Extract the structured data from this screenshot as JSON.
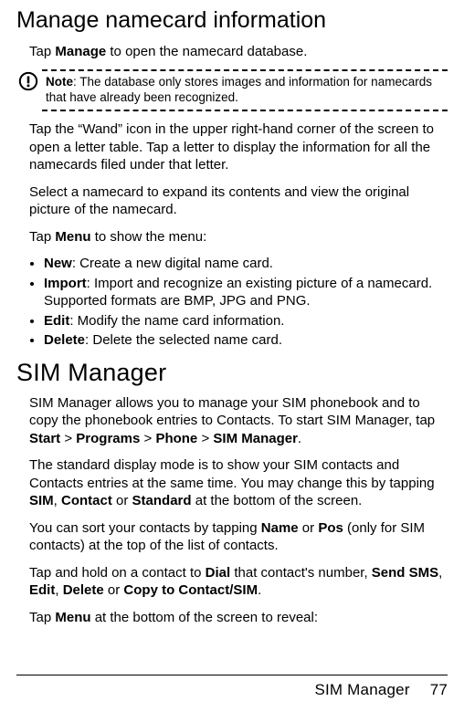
{
  "section1": {
    "title": "Manage namecard information",
    "p1_pre": "Tap ",
    "p1_bold": "Manage",
    "p1_post": " to open the namecard database.",
    "note_label": "Note",
    "note_text": ": The database only stores images and information for namecards that have already been recognized.",
    "p2": "Tap the “Wand” icon in the upper right-hand corner of the screen to open a letter table. Tap a letter to display the information for all the namecards filed under that letter.",
    "p3": "Select a namecard to expand its contents and view the original picture of the namecard.",
    "p4_pre": "Tap ",
    "p4_bold": "Menu",
    "p4_post": " to show the menu:",
    "menu": [
      {
        "name": "New",
        "desc": ": Create a new digital name card."
      },
      {
        "name": "Import",
        "desc": ": Import and recognize an existing picture of a namecard. Supported formats are BMP, JPG and PNG."
      },
      {
        "name": "Edit",
        "desc": ": Modify the name card information."
      },
      {
        "name": "Delete",
        "desc": ": Delete the selected name card."
      }
    ]
  },
  "section2": {
    "title": "SIM Manager",
    "p1_a": "SIM Manager allows you to manage your SIM phonebook and to copy the phonebook entries to Contacts. To start SIM Manager, tap ",
    "p1_b1": "Start",
    "p1_gt": " > ",
    "p1_b2": "Programs",
    "p1_b3": "Phone",
    "p1_b4": "SIM Manager",
    "p1_end": ".",
    "p2_a": "The standard display mode is to show your SIM contacts and Contacts entries at the same time. You may change this by tapping ",
    "p2_b1": "SIM",
    "p2_c1": ", ",
    "p2_b2": "Contact",
    "p2_c2": " or ",
    "p2_b3": "Standard",
    "p2_end": " at the bottom of the screen.",
    "p3_a": "You can sort your contacts by tapping ",
    "p3_b1": "Name",
    "p3_c1": " or ",
    "p3_b2": "Pos",
    "p3_end": " (only for SIM contacts) at the top of the list of contacts.",
    "p4_a": "Tap and hold on a contact to ",
    "p4_b1": "Dial",
    "p4_mid1": " that contact's number, ",
    "p4_b2": "Send SMS",
    "p4_c1": ", ",
    "p4_b3": "Edit",
    "p4_c2": ", ",
    "p4_b4": "Delete",
    "p4_c3": " or ",
    "p4_b5": "Copy to Contact/SIM",
    "p4_end": ".",
    "p5_a": "Tap ",
    "p5_b1": "Menu",
    "p5_end": " at the bottom of the screen to reveal:"
  },
  "footer": {
    "section": "SIM Manager",
    "page": "77"
  }
}
